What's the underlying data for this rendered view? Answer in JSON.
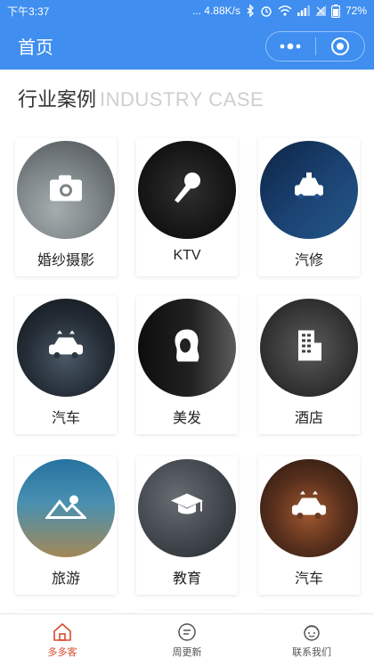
{
  "status_bar": {
    "time": "下午3:37",
    "speed": "... 4.88K/s",
    "battery": "72%"
  },
  "header": {
    "title": "首页"
  },
  "section": {
    "title_cn": "行业案例",
    "title_en": "INDUSTRY CASE"
  },
  "cases": [
    {
      "label": "婚纱摄影",
      "icon": "camera-icon"
    },
    {
      "label": "KTV",
      "icon": "microphone-icon"
    },
    {
      "label": "汽修",
      "icon": "car-repair-icon"
    },
    {
      "label": "汽车",
      "icon": "car-icon"
    },
    {
      "label": "美发",
      "icon": "hair-icon"
    },
    {
      "label": "酒店",
      "icon": "hotel-icon"
    },
    {
      "label": "旅游",
      "icon": "landscape-icon"
    },
    {
      "label": "教育",
      "icon": "graduation-cap-icon"
    },
    {
      "label": "汽车",
      "icon": "car-icon"
    }
  ],
  "tabbar": {
    "tabs": [
      {
        "label": "多多客",
        "icon": "home-icon",
        "active": true
      },
      {
        "label": "周更新",
        "icon": "update-icon",
        "active": false
      },
      {
        "label": "联系我们",
        "icon": "contact-icon",
        "active": false
      }
    ]
  },
  "colors": {
    "brand": "#3f8ef0",
    "active_tab": "#d84b2f"
  }
}
